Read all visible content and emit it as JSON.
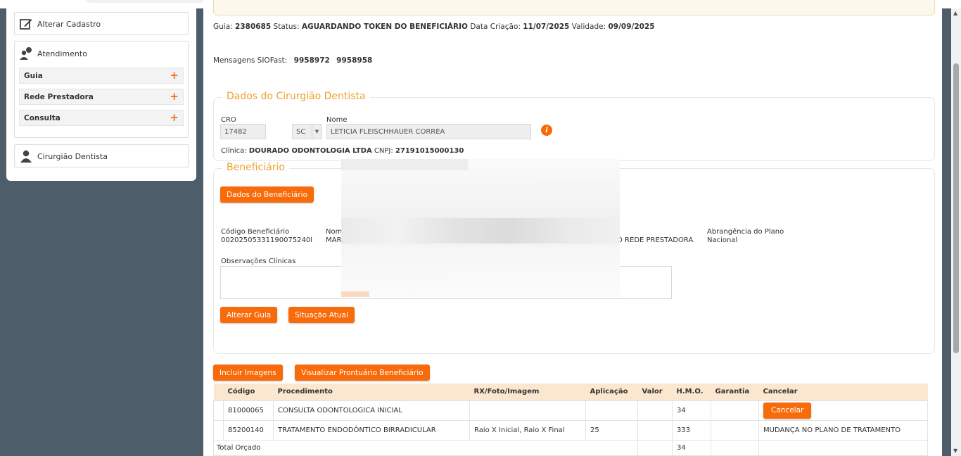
{
  "sidebar": {
    "alterar_cadastro": "Alterar Cadastro",
    "atendimento": "Atendimento",
    "items": [
      {
        "label": "Guia"
      },
      {
        "label": "Rede Prestadora"
      },
      {
        "label": "Consulta"
      }
    ],
    "plus": "+",
    "cirurgiao": "Cirurgião Dentista"
  },
  "guia": {
    "guia_label": "Guia:",
    "guia_value": "2380685",
    "status_label": "Status:",
    "status_value": "AGUARDANDO TOKEN DO BENEFICIÁRIO",
    "criacao_label": "Data Criação:",
    "criacao_value": "11/07/2025",
    "validade_label": "Validade:",
    "validade_value": "09/09/2025"
  },
  "mensagens": {
    "label": "Mensagens SIOFast:",
    "values": [
      "9958972",
      "9958958"
    ]
  },
  "dentista": {
    "legend": "Dados do Cirurgião Dentista",
    "cro_label": "CRO",
    "cro_value": "17482",
    "uf_value": "SC",
    "nome_label": "Nome",
    "nome_value": "LETICIA FLEISCHHAUER CORREA",
    "info_icon": "i",
    "clinica_label": "Clínica:",
    "clinica_value": "DOURADO ODONTOLOGIA LTDA",
    "cnpj_label": "CNPJ:",
    "cnpj_value": "27191015000130"
  },
  "beneficiario": {
    "legend": "Beneficiário",
    "dados_button": "Dados do Beneficiário",
    "codigo_label": "Código Beneficiário",
    "codigo_value": "00202505331190075240l",
    "nome_label": "Nom",
    "nome_value": "MAR",
    "rede_value": "O REDE PRESTADORA",
    "abrangencia_label": "Abrangência do Plano",
    "abrangencia_value": "Nacional",
    "observacoes_label": "Observações Clínicas",
    "alterar_button": "Alterar Guia",
    "situacao_button": "Situação Atual"
  },
  "actions": {
    "incluir_imagens": "Incluir Imagens",
    "visualizar_prontuario": "Visualizar Prontuário Beneficiário"
  },
  "table": {
    "headers": [
      "Código",
      "Procedimento",
      "RX/Foto/Imagem",
      "Aplicação",
      "Valor",
      "H.M.O.",
      "Garantia",
      "Cancelar"
    ],
    "rows": [
      {
        "codigo": "81000065",
        "procedimento": "CONSULTA ODONTOLOGICA INICIAL",
        "rx": "",
        "aplicacao": "",
        "valor": "",
        "hmo": "34",
        "garantia": "",
        "cancelar": "Cancelar"
      },
      {
        "codigo": "85200140",
        "procedimento": "TRATAMENTO ENDODÔNTICO BIRRADICULAR",
        "rx": "Raio X Inicial, Raio X Final",
        "aplicacao": "25",
        "valor": "",
        "hmo": "333",
        "garantia": "",
        "cancelar": "MUDANÇA NO PLANO DE TRATAMENTO"
      }
    ],
    "total_label": "Total Orçado",
    "total_hmo": "34"
  },
  "colors": {
    "accent": "#f86b0a",
    "legend": "#f0a030",
    "sidebar_bg": "#4e5d6a",
    "table_header": "#fbe6cf"
  }
}
